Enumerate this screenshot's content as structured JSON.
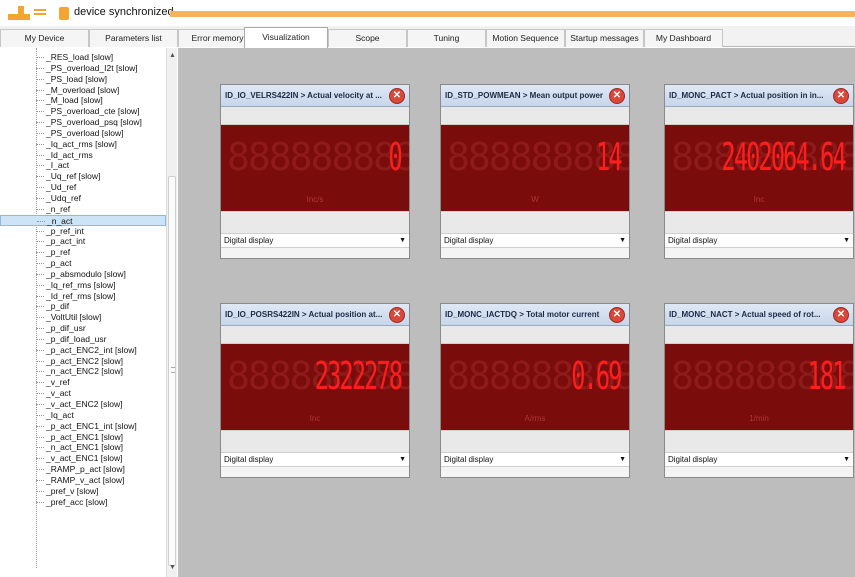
{
  "titlebar": {
    "status": "device synchronized"
  },
  "tabs": [
    {
      "label": "My Device"
    },
    {
      "label": "Parameters list"
    },
    {
      "label": "Error memory"
    },
    {
      "label": "Visualization"
    },
    {
      "label": "Scope"
    },
    {
      "label": "Tuning"
    },
    {
      "label": "Motion Sequence"
    },
    {
      "label": "Startup messages"
    },
    {
      "label": "My Dashboard"
    }
  ],
  "active_tab": "Visualization",
  "tree": {
    "selected": "_n_act",
    "items": [
      "_RES_load [slow]",
      "_PS_overload_I2t [slow]",
      "_PS_load [slow]",
      "_M_overload [slow]",
      "_M_load [slow]",
      "_PS_overload_cte [slow]",
      "_PS_overload_psq [slow]",
      "_PS_overload [slow]",
      "_Iq_act_rms [slow]",
      "_Id_act_rms",
      "_I_act",
      "_Uq_ref [slow]",
      "_Ud_ref",
      "_Udq_ref",
      "_n_ref",
      "_n_act",
      "_p_ref_int",
      "_p_act_int",
      "_p_ref",
      "_p_act",
      "_p_absmodulo [slow]",
      "_Iq_ref_rms [slow]",
      "_Id_ref_rms [slow]",
      "_p_dif",
      "_VoltUtil [slow]",
      "_p_dif_usr",
      "_p_dif_load_usr",
      "_p_act_ENC2_int [slow]",
      "_p_act_ENC2 [slow]",
      "_n_act_ENC2 [slow]",
      "_v_ref",
      "_v_act",
      "_v_act_ENC2 [slow]",
      "_Iq_act",
      "_p_act_ENC1_int [slow]",
      "_p_act_ENC1 [slow]",
      "_n_act_ENC1 [slow]",
      "_v_act_ENC1 [slow]",
      "_RAMP_p_act [slow]",
      "_RAMP_v_act [slow]",
      "_pref_v [slow]",
      "_pref_acc [slow]"
    ]
  },
  "panels": [
    {
      "title": "ID_IO_VELRS422IN > Actual velocity at ...",
      "ghost": "8888888888",
      "value": "0",
      "unit": "Inc/s",
      "mode": "Digital display"
    },
    {
      "title": "ID_STD_POWMEAN > Mean output power",
      "ghost": "8888888888",
      "value": "14",
      "unit": "W",
      "mode": "Digital display"
    },
    {
      "title": "ID_MONC_PACT > Actual position in in...",
      "ghost": "8888888888",
      "value": "2402064.64",
      "unit": "Inc",
      "mode": "Digital display"
    },
    {
      "title": "ID_IO_POSRS422IN > Actual position at...",
      "ghost": "8888888888",
      "value": "2322278",
      "unit": "Inc",
      "mode": "Digital display"
    },
    {
      "title": "ID_MONC_IACTDQ > Total motor current",
      "ghost": "8888888888",
      "value": "0.69",
      "unit": "A/rms",
      "mode": "Digital display"
    },
    {
      "title": "ID_MONC_NACT > Actual speed of rot...",
      "ghost": "8888888888",
      "value": "181",
      "unit": "1/min",
      "mode": "Digital display"
    }
  ],
  "colors": {
    "accent": "#f4a531",
    "display_bg": "#7a0c0c",
    "display_digits": "#ff1e1e",
    "main_bg": "#bdbdbd"
  }
}
